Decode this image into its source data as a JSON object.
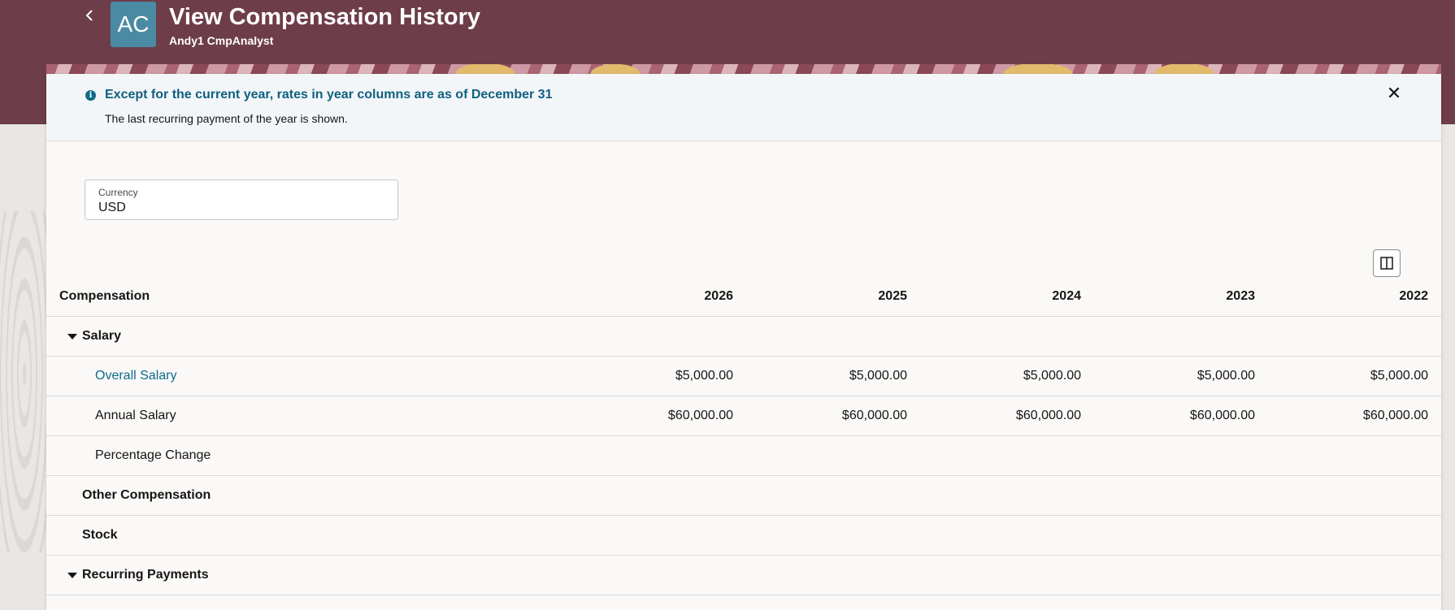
{
  "header": {
    "back_icon": "chevron-left-icon",
    "avatar_initials": "AC",
    "title": "View Compensation History",
    "subtitle": "Andy1 CmpAnalyst",
    "brand_color": "#6e3d4a"
  },
  "banner": {
    "icon": "info-icon",
    "title": "Except for the current year, rates in year columns are as of December 31",
    "text": "The last recurring payment of the year is shown.",
    "close_icon": "close-icon",
    "close_glyph": "✕"
  },
  "currency": {
    "label": "Currency",
    "value": "USD"
  },
  "table": {
    "columns": [
      "Compensation",
      "2026",
      "2025",
      "2024",
      "2023",
      "2022"
    ],
    "rows": [
      {
        "label": "Salary",
        "type": "group",
        "expanded": true,
        "values": [
          "",
          "",
          "",
          "",
          ""
        ]
      },
      {
        "label": "Overall Salary",
        "type": "link",
        "values": [
          "$5,000.00",
          "$5,000.00",
          "$5,000.00",
          "$5,000.00",
          "$5,000.00"
        ]
      },
      {
        "label": "Annual Salary",
        "type": "item",
        "values": [
          "$60,000.00",
          "$60,000.00",
          "$60,000.00",
          "$60,000.00",
          "$60,000.00"
        ]
      },
      {
        "label": "Percentage Change",
        "type": "item",
        "values": [
          "",
          "",
          "",
          "",
          ""
        ]
      },
      {
        "label": "Other Compensation",
        "type": "group-plain",
        "values": [
          "",
          "",
          "",
          "",
          ""
        ]
      },
      {
        "label": "Stock",
        "type": "group-plain",
        "values": [
          "",
          "",
          "",
          "",
          ""
        ]
      },
      {
        "label": "Recurring Payments",
        "type": "group",
        "expanded": true,
        "values": [
          "",
          "",
          "",
          "",
          ""
        ]
      }
    ]
  },
  "icons": {
    "panel_toggle": "columns-panel-icon",
    "expand": "caret-down-icon"
  }
}
